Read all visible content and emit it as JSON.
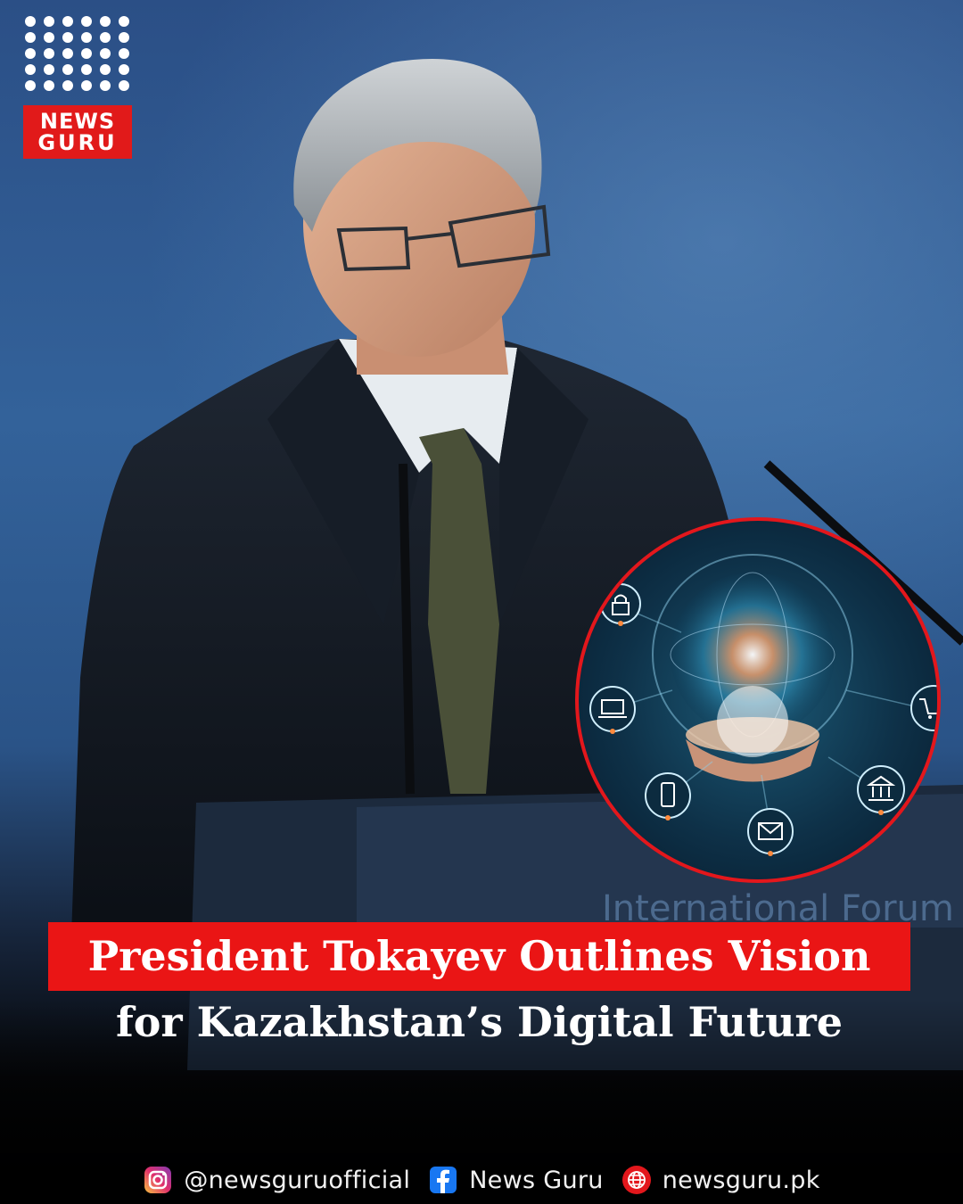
{
  "brand": {
    "logo_line1": "NEWS",
    "logo_line2": "GURU",
    "accent_color": "#e11a1a"
  },
  "background": {
    "podium_text": "International Forum"
  },
  "inset": {
    "icons": [
      "lock-icon",
      "laptop-icon",
      "phone-icon",
      "mail-icon",
      "bank-icon",
      "cart-icon"
    ]
  },
  "headline": {
    "line1": "President Tokayev Outlines Vision",
    "line2": "for Kazakhstan’s Digital Future"
  },
  "footer": {
    "instagram": "@newsguruofficial",
    "facebook": "News Guru",
    "website": "newsguru.pk"
  }
}
